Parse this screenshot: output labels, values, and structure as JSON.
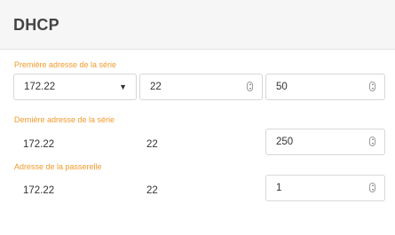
{
  "panel": {
    "title": "DHCP"
  },
  "first_address": {
    "label": "Première adresse de la série",
    "prefix_select_value": "172.22",
    "octet3_value": "22",
    "octet4_value": "50"
  },
  "last_address": {
    "label": "Dernière adresse de la série",
    "prefix_value": "172.22",
    "octet3_value": "22",
    "octet4_value": "250"
  },
  "gateway": {
    "label": "Adresse de la passerelle",
    "prefix_value": "172.22",
    "octet3_value": "22",
    "octet4_value": "1"
  },
  "icons": {
    "dropdown": "caret-down-icon",
    "spinner": "spinner-arrows-icon"
  },
  "colors": {
    "label_accent": "#f39a2b",
    "header_background": "#f6f6f6"
  }
}
